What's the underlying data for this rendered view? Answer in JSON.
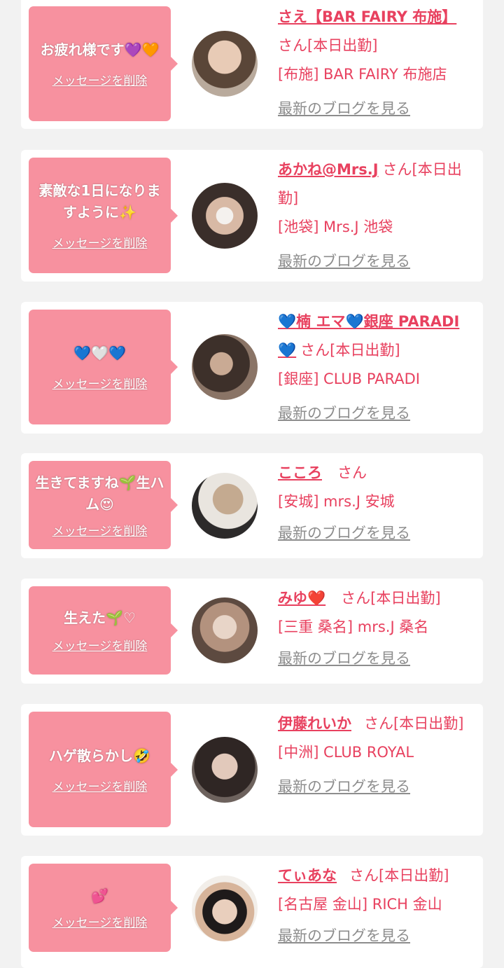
{
  "entries": [
    {
      "message": "お疲れ様です💜🧡",
      "delete_label": "メッセージを削除",
      "name": "さえ【BAR FAIRY 布施】",
      "san": "さん[本日出勤]",
      "shop": "[布施] BAR FAIRY 布施店",
      "blog": "最新のブログを見る"
    },
    {
      "message": "素敵な1日になりますように✨",
      "delete_label": "メッセージを削除",
      "name": "あかね@Mrs.J",
      "san": "さん[本日出勤]",
      "shop": "[池袋] Mrs.J 池袋",
      "blog": "最新のブログを見る"
    },
    {
      "message": "💙🤍💙",
      "delete_label": "メッセージを削除",
      "name": "💙楠 エマ💙銀座 PARADI💙",
      "san": "さん[本日出勤]",
      "shop": "[銀座] CLUB PARADI",
      "blog": "最新のブログを見る"
    },
    {
      "message": "生きてますね🌱生ハム😍",
      "delete_label": "メッセージを削除",
      "name": "こころ",
      "san": "さん",
      "shop": "[安城] mrs.J 安城",
      "blog": "最新のブログを見る"
    },
    {
      "message": "生えた🌱♡",
      "delete_label": "メッセージを削除",
      "name": "みゆ❤️",
      "san": "さん[本日出勤]",
      "shop": "[三重 桑名] mrs.J 桑名",
      "blog": "最新のブログを見る"
    },
    {
      "message": "ハゲ散らかし🤣",
      "delete_label": "メッセージを削除",
      "name": "伊藤れいか",
      "san": "さん[本日出勤]",
      "shop": "[中洲] CLUB ROYAL",
      "blog": "最新のブログを見る"
    },
    {
      "message": "💕",
      "delete_label": "メッセージを削除",
      "name": "てぃあな",
      "san": "さん[本日出勤]",
      "shop": "[名古屋 金山] RICH 金山",
      "blog": "最新のブログを見る"
    }
  ],
  "colors": {
    "bubble": "#f7919f",
    "accent": "#e8415f",
    "blog_link": "#8d8d8d",
    "background": "#f2f2f2"
  }
}
